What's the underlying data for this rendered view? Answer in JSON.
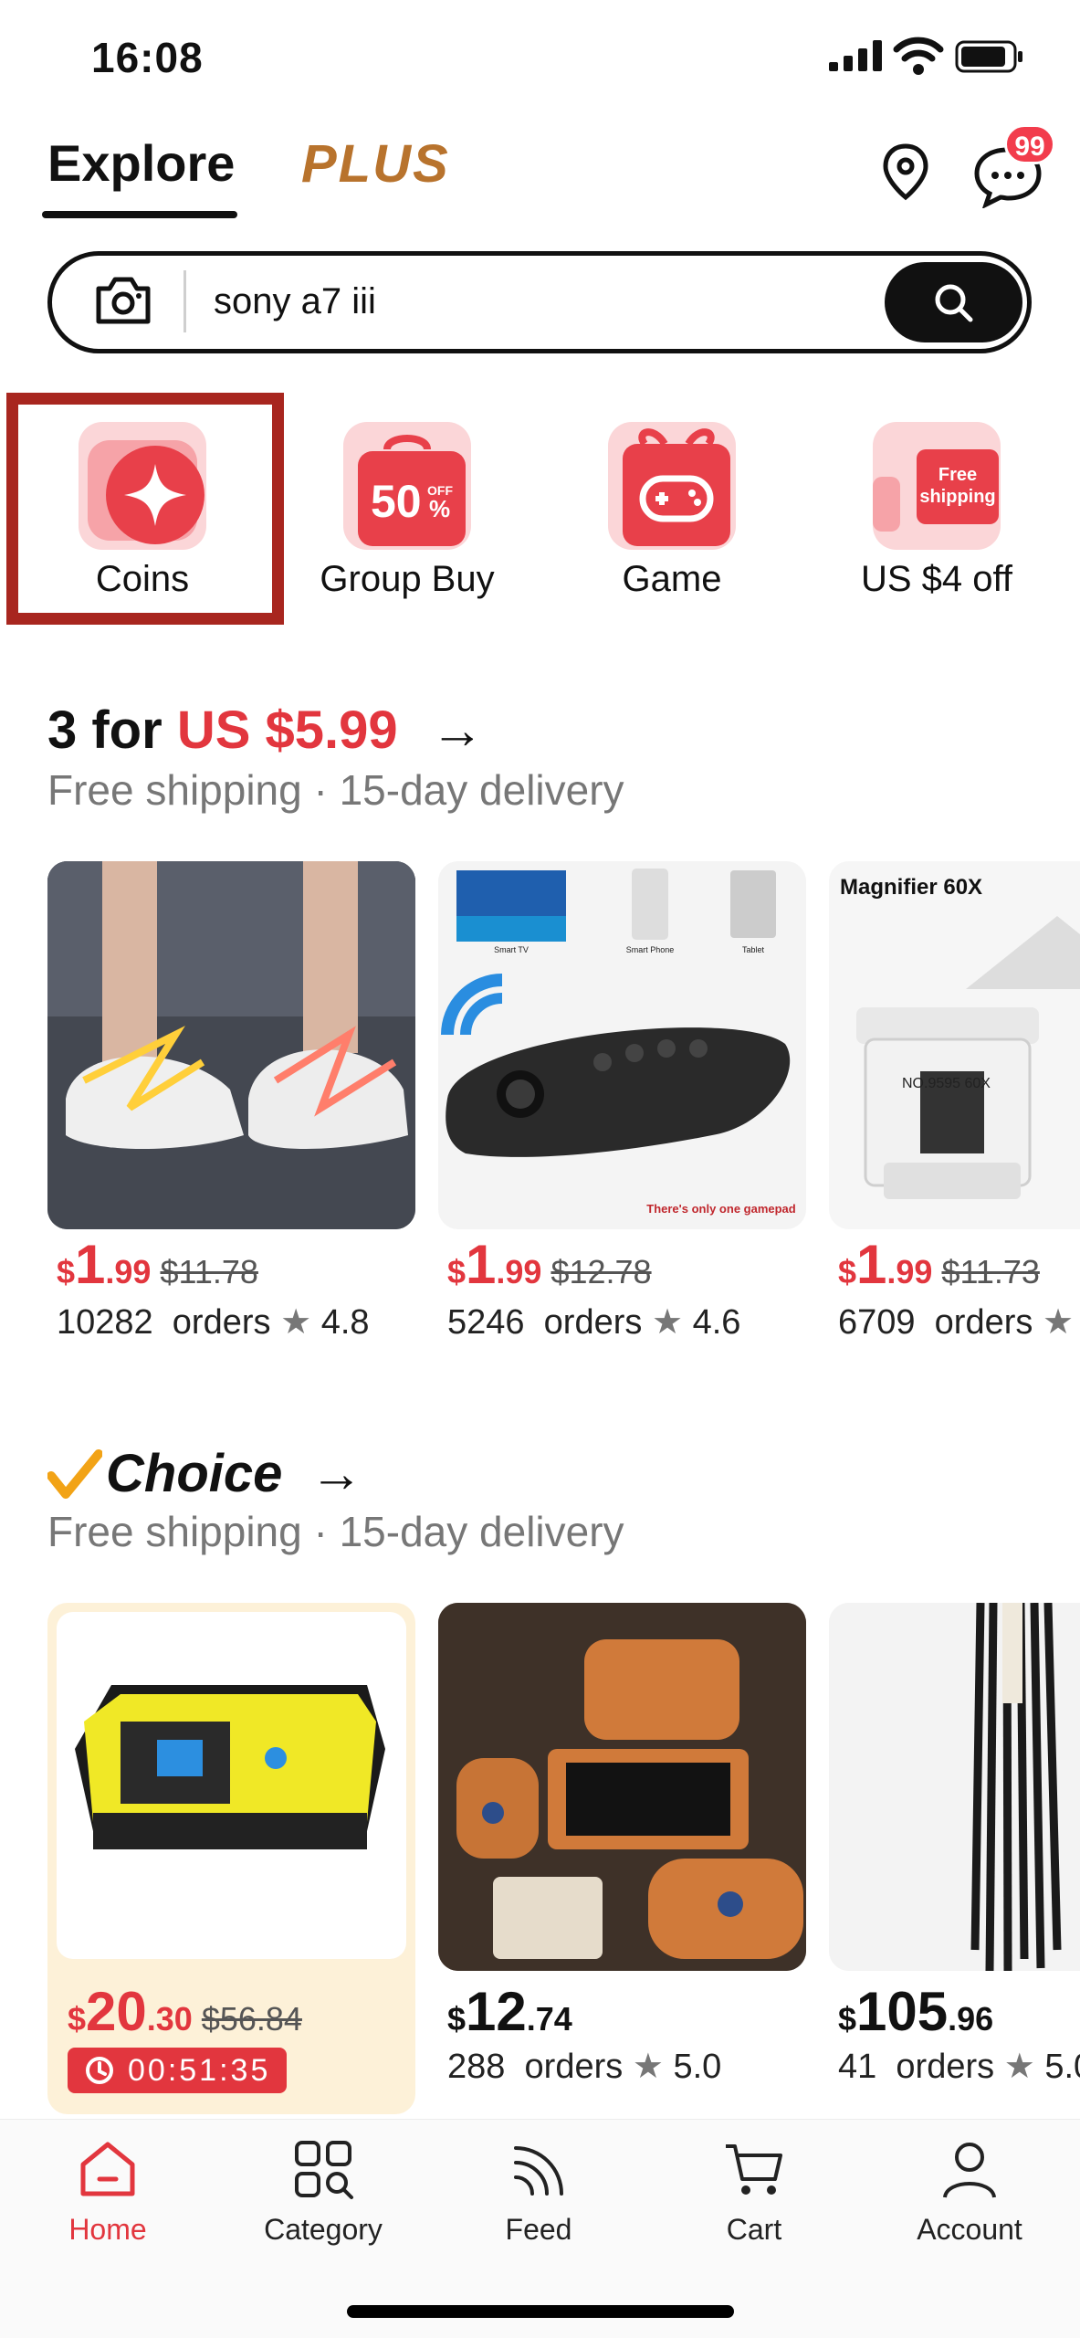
{
  "status_bar": {
    "time": "16:08"
  },
  "header": {
    "tabs": [
      {
        "label": "Explore"
      },
      {
        "label": "PLUS"
      }
    ],
    "message_badge": "99"
  },
  "search": {
    "value": "sony a7 iii"
  },
  "quick_actions": [
    {
      "label": "Coins",
      "icon": "coin-star-icon"
    },
    {
      "label": "Group Buy",
      "icon": "shopping-bag-50-off-icon",
      "badge_text": "50",
      "badge_sub": "OFF %"
    },
    {
      "label": "Game",
      "icon": "gift-gamepad-icon"
    },
    {
      "label": "US $4 off",
      "icon": "free-shipping-truck-icon",
      "badge_text": "Free shipping"
    }
  ],
  "section_deals": {
    "title_prefix": "3 for ",
    "title_highlight": "US $5.99",
    "subtitle": "Free shipping · 15-day delivery",
    "products": [
      {
        "price_whole": "1",
        "price_cents": ".99",
        "currency": "$",
        "original_price": "$11.78",
        "orders": "10282",
        "orders_label": "orders",
        "rating": "4.8"
      },
      {
        "price_whole": "1",
        "price_cents": ".99",
        "currency": "$",
        "original_price": "$12.78",
        "orders": "5246",
        "orders_label": "orders",
        "rating": "4.6",
        "image_labels": [
          "Smart TV",
          "Smart Phone",
          "Tablet",
          "There's only one gamepad"
        ]
      },
      {
        "price_whole": "1",
        "price_cents": ".99",
        "currency": "$",
        "original_price": "$11.73",
        "orders": "6709",
        "orders_label": "orders",
        "rating": "",
        "image_labels": [
          "Magnifier 60X",
          "NO.9595 60X"
        ]
      }
    ]
  },
  "section_choice": {
    "title": "Choice",
    "subtitle": "Free shipping · 15-day delivery",
    "products": [
      {
        "currency": "$",
        "price_whole": "20",
        "price_cents": ".30",
        "original_price": "$56.84",
        "timer": "00:51:35"
      },
      {
        "currency": "$",
        "price_whole": "12",
        "price_cents": ".74",
        "orders": "288",
        "orders_label": "orders",
        "rating": "5.0"
      },
      {
        "currency": "$",
        "price_whole": "105",
        "price_cents": ".96",
        "orders": "41",
        "orders_label": "orders",
        "rating": "5.0"
      }
    ]
  },
  "bottom_nav": [
    {
      "label": "Home",
      "active": true
    },
    {
      "label": "Category"
    },
    {
      "label": "Feed"
    },
    {
      "label": "Cart"
    },
    {
      "label": "Account"
    }
  ],
  "colors": {
    "accent": "#e2363e",
    "plus": "#b8732d",
    "highlight": "#a8261f"
  }
}
